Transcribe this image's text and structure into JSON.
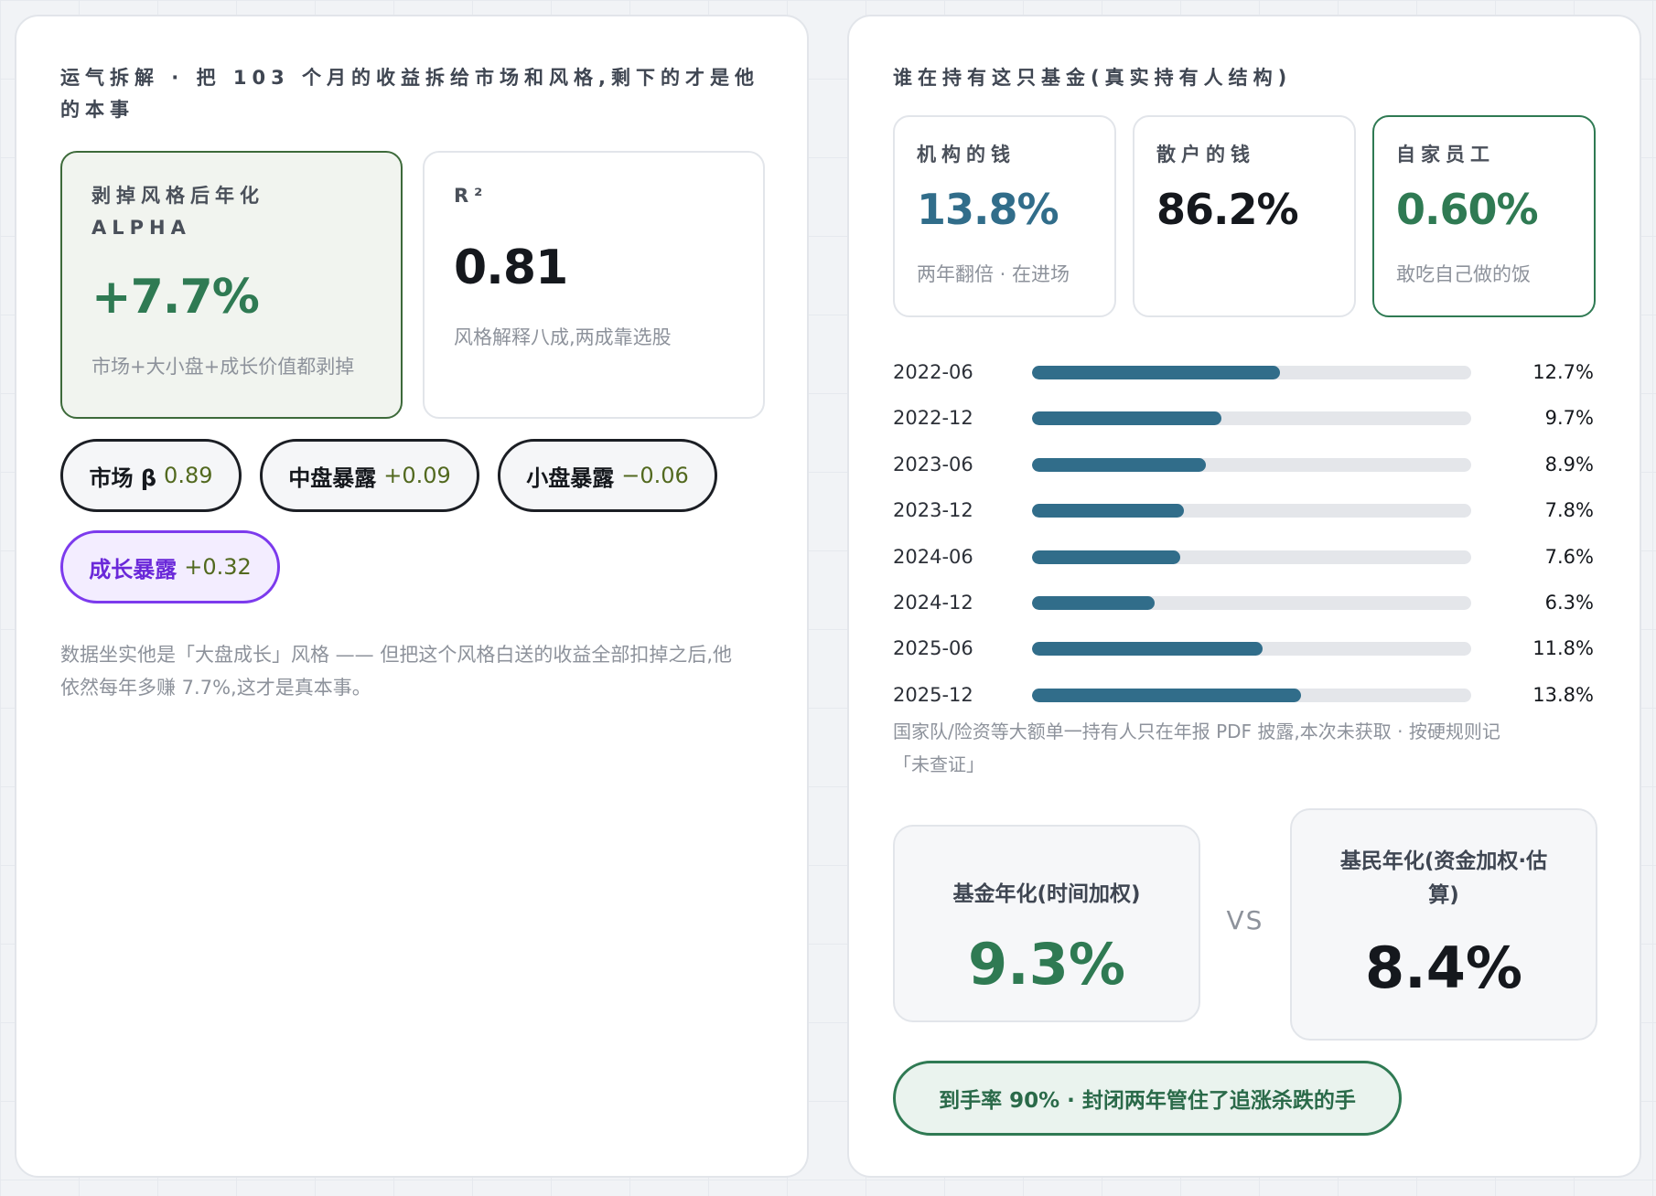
{
  "colors": {
    "green": "#2f7a53",
    "teal": "#316d8a",
    "dark": "#15181d",
    "purple": "#6a28d9",
    "olive": "#52691f"
  },
  "left": {
    "heading_line1": "运气拆解 · 把 103 个月的收益拆给市场和风格,剩下的才是他",
    "heading_line2": "的本事",
    "alpha": {
      "label_line1": "剥掉风格后年化",
      "label_line2": "ALPHA",
      "value": "+7.7%",
      "note": "市场+大小盘+成长价值都剥掉"
    },
    "r2": {
      "label": "R²",
      "value": "0.81",
      "note": "风格解释八成,两成靠选股"
    },
    "exposures": [
      {
        "name": "市场 β",
        "value": "0.89"
      },
      {
        "name": "中盘暴露",
        "value": "+0.09"
      },
      {
        "name": "小盘暴露",
        "value": "−0.06"
      },
      {
        "name": "成长暴露",
        "value": "+0.32"
      }
    ],
    "footnote_line1": "数据坐实他是「大盘成长」风格 —— 但把这个风格白送的收益全部扣掉之后,他",
    "footnote_line2": "依然每年多赚 7.7%,这才是真本事。"
  },
  "right": {
    "heading": "谁在持有这只基金(真实持有人结构)",
    "holders": [
      {
        "label": "机构的钱",
        "value": "13.8%",
        "note": "两年翻倍 · 在进场"
      },
      {
        "label": "散户的钱",
        "value": "86.2%",
        "note": ""
      },
      {
        "label": "自家员工",
        "value": "0.60%",
        "note": "敢吃自己做的饭"
      }
    ],
    "history": [
      {
        "date": "2022-06",
        "value": 12.7,
        "label": "12.7%"
      },
      {
        "date": "2022-12",
        "value": 9.7,
        "label": "9.7%"
      },
      {
        "date": "2023-06",
        "value": 8.9,
        "label": "8.9%"
      },
      {
        "date": "2023-12",
        "value": 7.8,
        "label": "7.8%"
      },
      {
        "date": "2024-06",
        "value": 7.6,
        "label": "7.6%"
      },
      {
        "date": "2024-12",
        "value": 6.3,
        "label": "6.3%"
      },
      {
        "date": "2025-06",
        "value": 11.8,
        "label": "11.8%"
      },
      {
        "date": "2025-12",
        "value": 13.8,
        "label": "13.8%"
      }
    ],
    "history_max": 22.5,
    "history_note_line1": "国家队/险资等大额单一持有人只在年报 PDF 披露,本次未获取 · 按硬规则记",
    "history_note_line2": "「未查证」",
    "compare": {
      "fund_label": "基金年化(时间加权)",
      "fund_value": "9.3%",
      "vs": "VS",
      "investor_label": "基民年化(资金加权·估算)",
      "investor_value": "8.4%"
    },
    "footer_pill": "到手率 90% · 封闭两年管住了追涨杀跌的手"
  }
}
